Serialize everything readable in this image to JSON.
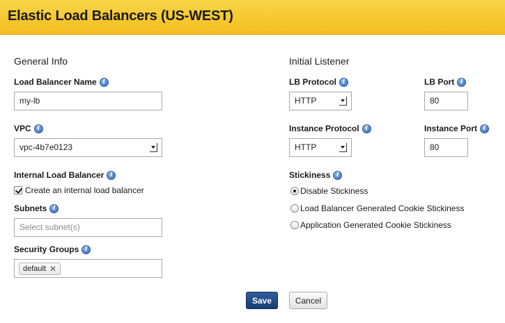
{
  "header": {
    "title": "Elastic Load Balancers (US-WEST)"
  },
  "general": {
    "section_title": "General Info",
    "lb_name": {
      "label": "Load Balancer Name",
      "value": "my-lb"
    },
    "vpc": {
      "label": "VPC",
      "value": "vpc-4b7e0123"
    },
    "internal": {
      "label": "Internal Load Balancer",
      "checkbox_label": "Create an internal load balancer",
      "checked": true
    },
    "subnets": {
      "label": "Subnets",
      "placeholder": "Select subnet(s)"
    },
    "security_groups": {
      "label": "Security Groups",
      "tags": [
        "default"
      ]
    }
  },
  "listener": {
    "section_title": "Initial Listener",
    "lb_protocol": {
      "label": "LB Protocol",
      "value": "HTTP"
    },
    "lb_port": {
      "label": "LB Port",
      "value": "80"
    },
    "instance_protocol": {
      "label": "Instance Protocol",
      "value": "HTTP"
    },
    "instance_port": {
      "label": "Instance Port",
      "value": "80"
    },
    "stickiness": {
      "label": "Stickiness",
      "options": [
        {
          "label": "Disable Stickiness",
          "checked": true
        },
        {
          "label": "Load Balancer Generated Cookie Stickiness",
          "checked": false
        },
        {
          "label": "Application Generated Cookie Stickiness",
          "checked": false
        }
      ]
    }
  },
  "actions": {
    "save_label": "Save",
    "cancel_label": "Cancel"
  },
  "colors": {
    "header_bg": "#f6c22b",
    "save_bg": "#1f4a85",
    "info_icon": "#3a74c4"
  },
  "icons": {
    "info": "info-icon",
    "tag_remove": "close-icon",
    "select_arrow": "chevron-down-icon"
  }
}
